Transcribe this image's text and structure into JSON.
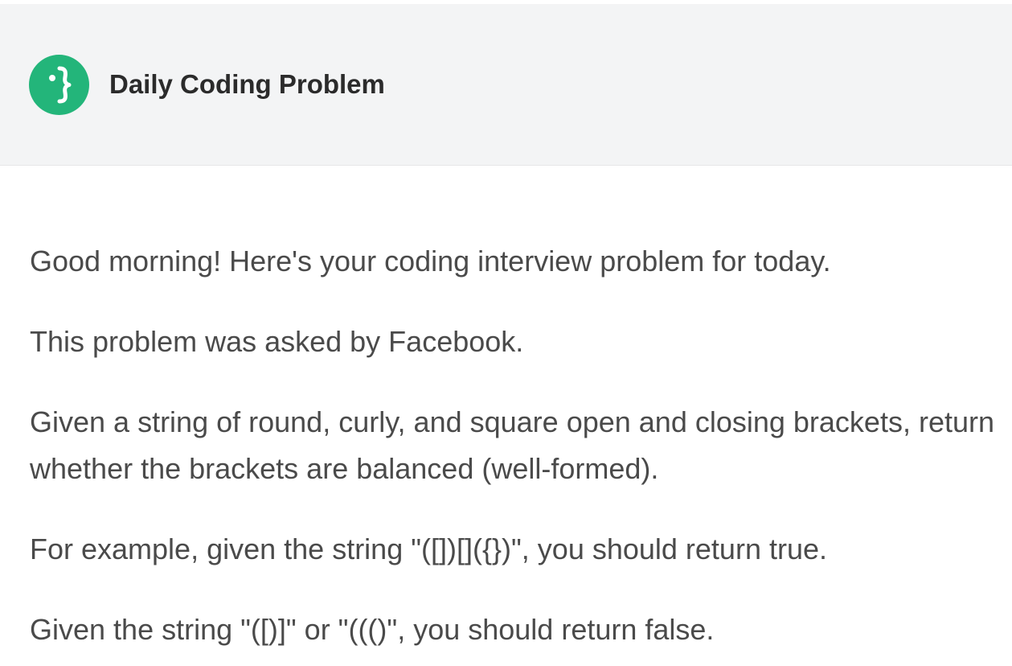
{
  "header": {
    "brand_name": "Daily Coding Problem",
    "logo_icon": "curly-brace-face-icon",
    "logo_color": "#23b57a",
    "background": "#f3f4f5"
  },
  "email": {
    "paragraphs": [
      "Good morning! Here's your coding interview problem for today.",
      "This problem was asked by Facebook.",
      "Given a string of round, curly, and square open and closing brackets, return whether the brackets are balanced (well-formed).",
      "For example, given the string \"([])[]({})\", you should return true.",
      "Given the string \"([)]\" or \"((()\", you should return false."
    ]
  },
  "colors": {
    "text": "#4a4a4a",
    "brand_text": "#2b2b2b"
  }
}
